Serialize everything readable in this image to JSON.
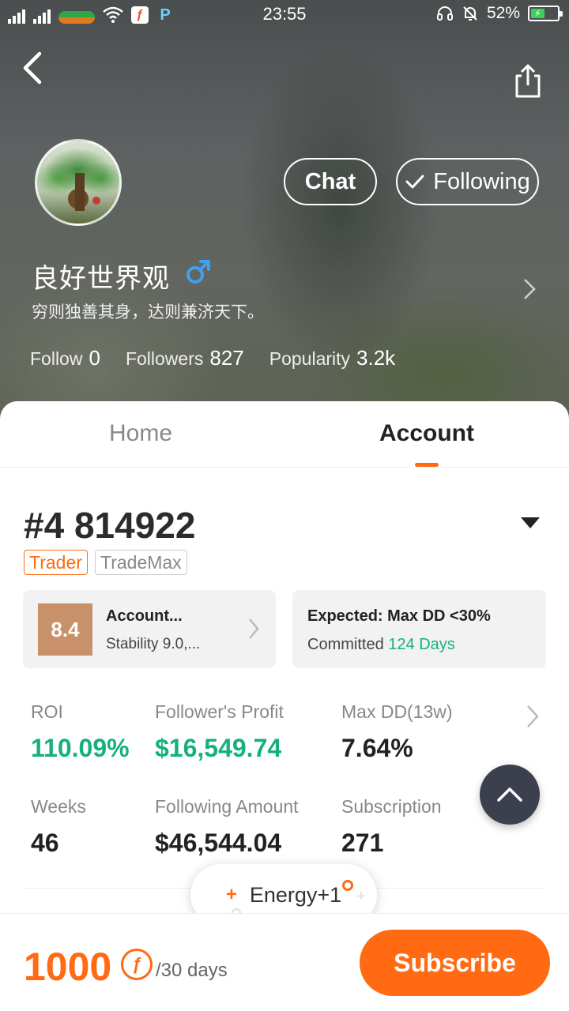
{
  "status_bar": {
    "time": "23:55",
    "battery": "52%",
    "icons": [
      "signal-icon",
      "signal-icon",
      "carrier-badge-icon",
      "wifi-icon",
      "app-notification-icon",
      "app-notification-icon",
      "headset-icon",
      "mute-bell-icon",
      "battery-icon"
    ]
  },
  "header": {
    "back_icon": "chevron-left-icon",
    "share_icon": "share-icon"
  },
  "profile": {
    "username": "良好世界观",
    "gender": "♂",
    "bio": "穷则独善其身，达则兼济天下。",
    "chat_label": "Chat",
    "following_label": "Following",
    "stats": {
      "follow_label": "Follow",
      "follow_value": "0",
      "followers_label": "Followers",
      "followers_value": "827",
      "popularity_label": "Popularity",
      "popularity_value": "3.2k"
    }
  },
  "tabs": {
    "home": "Home",
    "account": "Account",
    "active": "Account"
  },
  "account": {
    "title": "#4 814922",
    "tags": [
      "Trader",
      "TradeMax"
    ],
    "score": "8.4",
    "score_title": "Account...",
    "score_sub": "Stability 9.0,...",
    "expected_title": "Expected: Max DD <30%",
    "committed_label": "Committed",
    "committed_value": "124 Days",
    "metrics": {
      "roi_label": "ROI",
      "roi_value": "110.09%",
      "profit_label": "Follower's Profit",
      "profit_value": "$16,549.74",
      "dd_label": "Max DD(13w)",
      "dd_value": "7.64%",
      "weeks_label": "Weeks",
      "weeks_value": "46",
      "amount_label": "Following Amount",
      "amount_value": "$46,544.04",
      "subscription_label": "Subscription",
      "subscription_value": "271"
    }
  },
  "energy_toast": {
    "plus": "+",
    "label": "Energy+1"
  },
  "bottom": {
    "price": "1000",
    "currency_symbol": "ƒ",
    "period": "/30 days",
    "subscribe_label": "Subscribe"
  },
  "colors": {
    "accent": "#ff6a13",
    "positive": "#15b07d",
    "score_bg": "#c9916a",
    "scroll_top_bg": "#3c3f4e"
  }
}
